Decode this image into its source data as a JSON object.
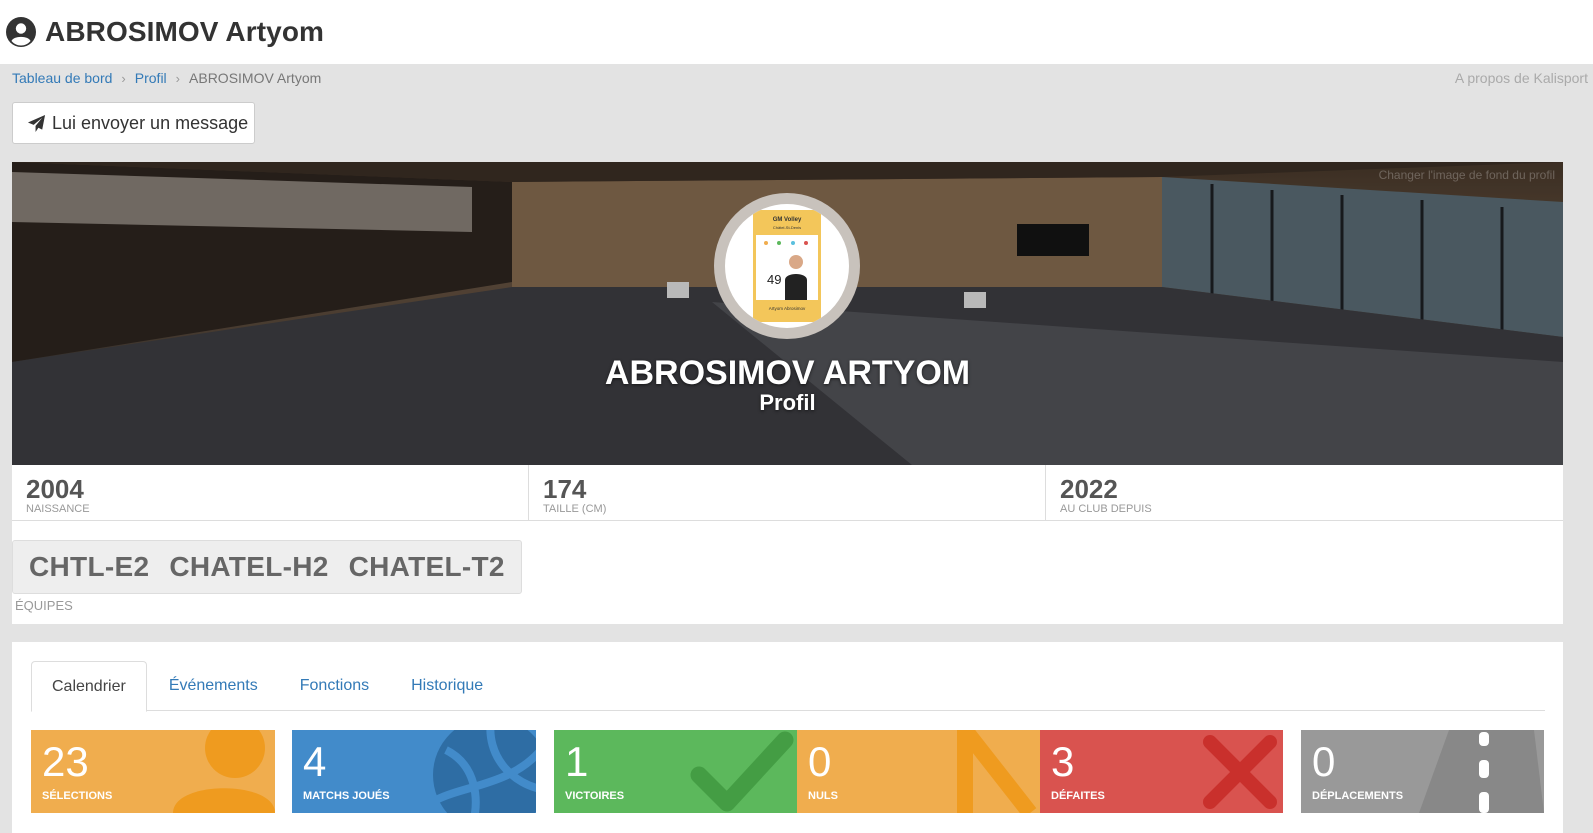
{
  "header": {
    "title": "ABROSIMOV Artyom"
  },
  "breadcrumb": {
    "items": [
      "Tableau de bord",
      "Profil",
      "ABROSIMOV Artyom"
    ],
    "about": "A propos de Kalisport"
  },
  "actions": {
    "message_label": "Lui envoyer un message"
  },
  "hero": {
    "name": "ABROSIMOV ARTYOM",
    "subtitle": "Profil",
    "credit": "Changer l'image de fond du profil",
    "card": {
      "club": "GM Volley",
      "club_sub": "Châtel-St-Denis",
      "number": "49",
      "player": "Artyom Abrosimov"
    }
  },
  "stats": [
    {
      "value": "2004",
      "label": "NAISSANCE"
    },
    {
      "value": "174",
      "label": "TAILLE (CM)"
    },
    {
      "value": "2022",
      "label": "AU CLUB DEPUIS"
    }
  ],
  "teams": {
    "items": [
      "CHTL-E2",
      "CHATEL-H2",
      "CHATEL-T2"
    ],
    "label": "ÉQUIPES"
  },
  "tabs": [
    {
      "label": "Calendrier",
      "active": true
    },
    {
      "label": "Événements"
    },
    {
      "label": "Fonctions"
    },
    {
      "label": "Historique"
    }
  ],
  "tiles": [
    {
      "value": "23",
      "label": "SÉLECTIONS",
      "color": "#f0ad4e",
      "icon": "user-icon"
    },
    {
      "value": "4",
      "label": "MATCHS JOUÉS",
      "color": "#428bca",
      "icon": "volleyball-icon"
    },
    {
      "value": "1",
      "label": "VICTOIRES",
      "color": "#5cb85c",
      "icon": "check-icon"
    },
    {
      "value": "0",
      "label": "NULS",
      "color": "#f0ad4e",
      "icon": "equal-icon"
    },
    {
      "value": "3",
      "label": "DÉFAITES",
      "color": "#d9534f",
      "icon": "x-icon"
    },
    {
      "value": "0",
      "label": "DÉPLACEMENTS",
      "color": "#999999",
      "icon": "road-icon"
    }
  ]
}
